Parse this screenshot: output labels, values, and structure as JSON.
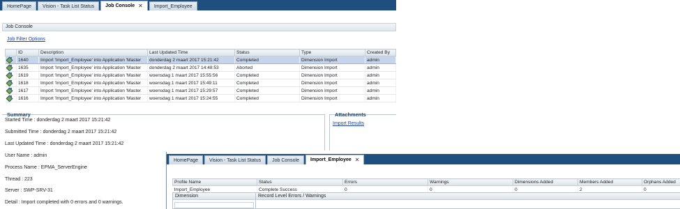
{
  "main_tabs": [
    {
      "label": "HomePage"
    },
    {
      "label": "Vision - Task List Status"
    },
    {
      "label": "Job Console",
      "close": "✕"
    },
    {
      "label": "Import_Employee"
    }
  ],
  "job_console": {
    "panel_title": "Job Console",
    "filter_link": "Job Filter Options",
    "columns": [
      "ID",
      "Description",
      "Last Updated Time",
      "Status",
      "Type",
      "Created By"
    ],
    "rows": [
      {
        "id": "1640",
        "description": "Import 'Import_Employee' into Application 'Master",
        "updated": "donderdag 2 maart 2017 15:21:42",
        "status": "Completed",
        "type": "Dimension Import",
        "created_by": "admin"
      },
      {
        "id": "1635",
        "description": "Import 'Import_Employee' into Application 'Master",
        "updated": "donderdag 2 maart 2017 14:48:53",
        "status": "Aborted",
        "type": "Dimension Import",
        "created_by": "admin"
      },
      {
        "id": "1619",
        "description": "Import 'Import_Employee' into Application 'Master",
        "updated": "woensdag 1 maart 2017 15:55:56",
        "status": "Completed",
        "type": "Dimension Import",
        "created_by": "admin"
      },
      {
        "id": "1618",
        "description": "Import 'Import_Employee' into Application 'Master",
        "updated": "woensdag 1 maart 2017 15:49:11",
        "status": "Completed",
        "type": "Dimension Import",
        "created_by": "admin"
      },
      {
        "id": "1617",
        "description": "Import 'Import_Employee' into Application 'Master",
        "updated": "woensdag 1 maart 2017 15:29:57",
        "status": "Completed",
        "type": "Dimension Import",
        "created_by": "admin"
      },
      {
        "id": "1616",
        "description": "Import 'Import_Employee' into Application 'Master",
        "updated": "woensdag 1 maart 2017 15:24:55",
        "status": "Completed",
        "type": "Dimension Import",
        "created_by": "admin"
      }
    ]
  },
  "summary": {
    "title": "Summary",
    "lines": [
      "Started Time : donderdag 2 maart 2017 15:21:42",
      "Submitted Time : donderdag 2 maart 2017 15:21:42",
      "Last Updated Time : donderdag 2 maart 2017 15:21:42",
      "User Name : admin",
      "Process Name : EPMA_ServerEngine",
      "Thread : 223",
      "Server : SWP-SRV-31",
      "Detail : Import completed with 0 errors and 0 warnings."
    ]
  },
  "attachments": {
    "title": "Attachments",
    "link": "Import Results"
  },
  "overlay_tabs": [
    {
      "label": "HomePage"
    },
    {
      "label": "Vision - Task List Status"
    },
    {
      "label": "Job Console"
    },
    {
      "label": "Import_Employee",
      "close": "✕"
    }
  ],
  "import_result": {
    "columns": [
      "Profile Name",
      "Status",
      "Errors",
      "Warnings",
      "Dimensions Added",
      "Members Added",
      "Orphans Added"
    ],
    "row": {
      "profile": "Import_Employee",
      "status": "Complete Success",
      "errors": "0",
      "warnings": "0",
      "dimensions_added": "0",
      "members_added": "2",
      "orphans_added": "0"
    },
    "dimension_header": "Dimension",
    "errors_header": "Record Level Errors / Warnings"
  }
}
